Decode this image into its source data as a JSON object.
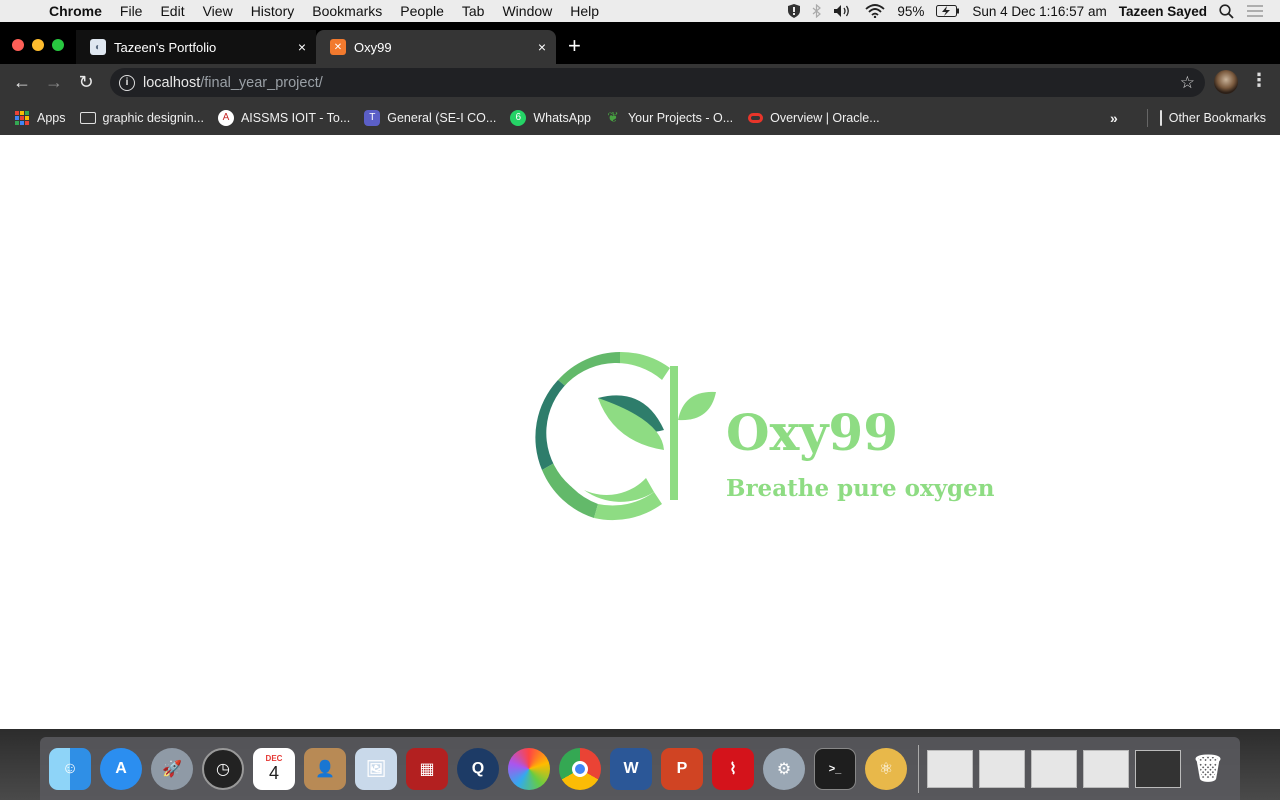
{
  "menubar": {
    "apple_icon": "apple-logo-icon",
    "app_name": "Chrome",
    "items": [
      "File",
      "Edit",
      "View",
      "History",
      "Bookmarks",
      "People",
      "Tab",
      "Window",
      "Help"
    ],
    "battery": "95%",
    "datetime": "Sun 4 Dec  1:16:57 am",
    "user": "Tazeen Sayed"
  },
  "tabs": [
    {
      "title": "Tazeen's Portfolio",
      "icon": "portfolio-favicon",
      "close": "×"
    },
    {
      "title": "Oxy99",
      "icon": "xampp-favicon",
      "close": "×"
    }
  ],
  "toolbar": {
    "url_host": "localhost",
    "url_path": "/final_year_project/"
  },
  "bookmarks": {
    "items": [
      {
        "label": "Apps",
        "icon": "apps-grid-icon"
      },
      {
        "label": "graphic designin...",
        "icon": "folder-icon"
      },
      {
        "label": "AISSMS IOIT - To...",
        "icon": "aissms-icon"
      },
      {
        "label": "General (SE-I CO...",
        "icon": "teams-icon"
      },
      {
        "label": "WhatsApp",
        "icon": "whatsapp-icon",
        "badge": "6"
      },
      {
        "label": "Your Projects - O...",
        "icon": "overleaf-icon"
      },
      {
        "label": "Overview | Oracle...",
        "icon": "oracle-icon"
      }
    ],
    "overflow": "»",
    "other": "Other Bookmarks"
  },
  "page": {
    "brand": "Oxy99",
    "tagline": "Breathe pure oxygen",
    "colors": {
      "light_green": "#8edc83",
      "mid_green": "#63b96a",
      "dark_teal": "#2e7d6b"
    }
  },
  "dock": {
    "calendar_month": "DEC",
    "calendar_day": "4",
    "apps": [
      "finder-icon",
      "app-store-icon",
      "launchpad-icon",
      "dashboard-icon",
      "calendar-icon",
      "contacts-icon",
      "preview-icon",
      "photo-booth-icon",
      "quicktime-icon",
      "photos-icon",
      "chrome-icon",
      "word-icon",
      "powerpoint-icon",
      "acrobat-icon",
      "system-preferences-icon",
      "terminal-icon",
      "atom-icon"
    ]
  }
}
